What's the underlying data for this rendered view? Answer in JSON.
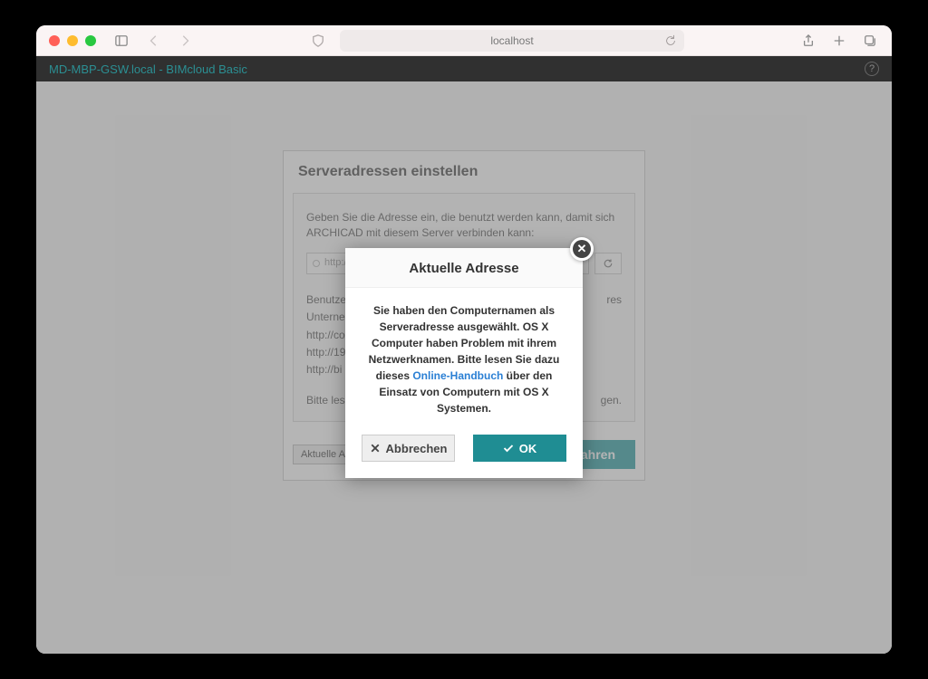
{
  "browser": {
    "url": "localhost"
  },
  "appbar": {
    "title": "MD-MBP-GSW.local - BIMcloud Basic"
  },
  "panel": {
    "title": "Serveradressen einstellen",
    "intro": "Geben Sie die Adresse ein, die benutzt werden kann, damit sich ARCHICAD mit diesem Server verbinden kann:",
    "input_placeholder": "http://",
    "hint_label": "Benutzer",
    "hint1": "Unternet",
    "hint_url1": "http://co",
    "hint_url2": "http://19",
    "hint_url3": "http://bi",
    "read_note": "Bitte lese",
    "hint_suffix": "res",
    "read_suffix": "gen.",
    "show_current": "Aktuelle Adressen anzeigen...",
    "continue": "Fortfahren"
  },
  "modal": {
    "title": "Aktuelle Adresse",
    "body_pre": "Sie haben den Computernamen als Serveradresse ausgewählt. OS X Computer haben Problem mit ihrem Netzwerknamen. Bitte lesen Sie dazu dieses ",
    "link": "Online-Handbuch",
    "body_post": " über den Einsatz von Computern mit OS X Systemen.",
    "cancel": "Abbrechen",
    "ok": "OK"
  }
}
